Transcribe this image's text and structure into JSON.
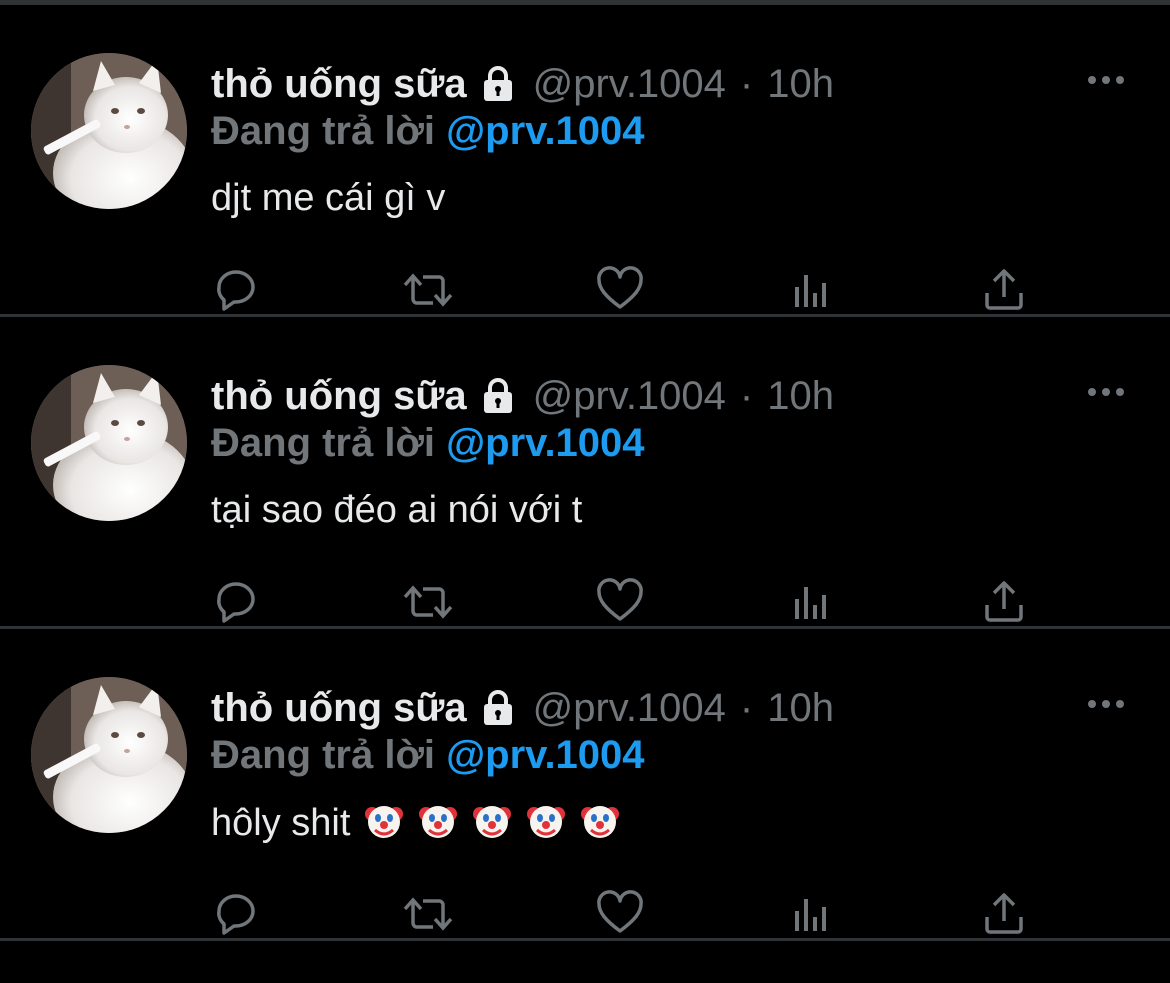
{
  "tweets": [
    {
      "display_name": "thỏ uống sữa",
      "handle": "@prv.1004",
      "separator": "·",
      "time": "10h",
      "reply_prefix": "Đang trả lời",
      "reply_mention": "@prv.1004",
      "text": "djt me cái gì v",
      "emojis": []
    },
    {
      "display_name": "thỏ uống sữa",
      "handle": "@prv.1004",
      "separator": "·",
      "time": "10h",
      "reply_prefix": "Đang trả lời",
      "reply_mention": "@prv.1004",
      "text": "tại sao đéo ai nói với t",
      "emojis": []
    },
    {
      "display_name": "thỏ uống sữa",
      "handle": "@prv.1004",
      "separator": "·",
      "time": "10h",
      "reply_prefix": "Đang trả lời",
      "reply_mention": "@prv.1004",
      "text": "hôly shit",
      "emojis": [
        "clown-face-icon",
        "clown-face-icon",
        "clown-face-icon",
        "clown-face-icon",
        "clown-face-icon"
      ]
    }
  ],
  "icons": {
    "lock": "lock-icon",
    "more": "more-icon",
    "actions": [
      "reply-icon",
      "retweet-icon",
      "like-icon",
      "analytics-icon",
      "share-icon"
    ]
  },
  "colors": {
    "background": "#000000",
    "text_primary": "#e7e9ea",
    "text_secondary": "#71767b",
    "mention": "#1d9bf0",
    "divider": "#2f3336"
  }
}
